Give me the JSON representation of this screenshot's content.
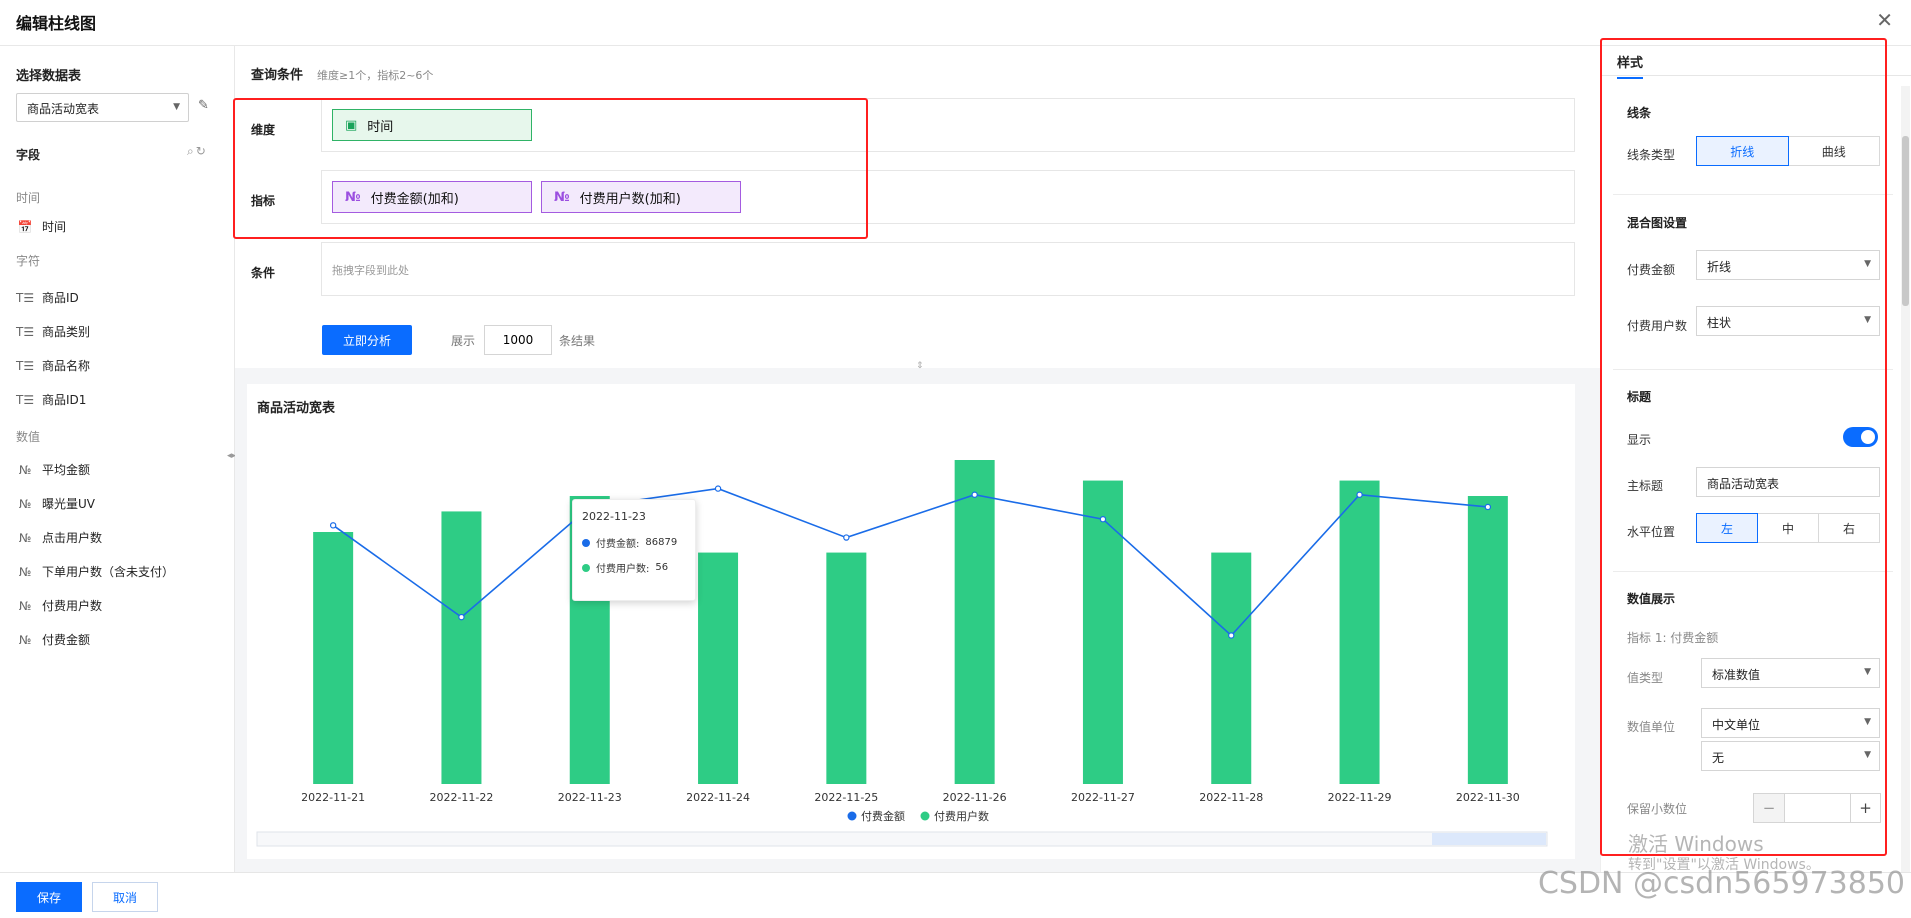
{
  "header": {
    "title": "编辑柱线图",
    "close_glyph": "✕"
  },
  "sidebar": {
    "title": "选择数据表",
    "dataset": "商品活动宽表",
    "fields_label": "字段",
    "groups": [
      {
        "label": "时间",
        "items": [
          {
            "label": "时间",
            "icon": "calendar-icon"
          }
        ]
      },
      {
        "label": "字符",
        "items": [
          {
            "label": "商品ID",
            "icon": "text-field-icon"
          },
          {
            "label": "商品类别",
            "icon": "text-field-icon"
          },
          {
            "label": "商品名称",
            "icon": "text-field-icon"
          },
          {
            "label": "商品ID1",
            "icon": "text-field-icon"
          }
        ]
      },
      {
        "label": "数值",
        "items": [
          {
            "label": "平均金额",
            "icon": "number-field-icon"
          },
          {
            "label": "曝光量UV",
            "icon": "number-field-icon"
          },
          {
            "label": "点击用户数",
            "icon": "number-field-icon"
          },
          {
            "label": "下单用户数（含未支付）",
            "icon": "number-field-icon"
          },
          {
            "label": "付费用户数",
            "icon": "number-field-icon"
          },
          {
            "label": "付费金额",
            "icon": "number-field-icon"
          }
        ]
      }
    ]
  },
  "query": {
    "title": "查询条件",
    "hint": "维度≥1个，指标2~6个",
    "dimension_label": "维度",
    "dimension_chip": "时间",
    "metric_label": "指标",
    "metric_chips": [
      "付费金额(加和)",
      "付费用户数(加和)"
    ],
    "condition_label": "条件",
    "condition_placeholder": "拖拽字段到此处",
    "analyze_button": "立即分析",
    "show_prefix": "展示",
    "limit": "1000",
    "show_suffix": "条结果",
    "number_glyph": "№"
  },
  "chart_data": {
    "type": "bar-line",
    "title": "商品活动宽表",
    "categories": [
      "2022-11-21",
      "2022-11-22",
      "2022-11-23",
      "2022-11-24",
      "2022-11-25",
      "2022-11-26",
      "2022-11-27",
      "2022-11-28",
      "2022-11-29",
      "2022-11-30"
    ],
    "series": [
      {
        "name": "付费金额",
        "type": "line",
        "color": "#1a6ce8",
        "values": [
          79000,
          64000,
          82000,
          85000,
          77000,
          84000,
          80000,
          61000,
          84000,
          82000
        ]
      },
      {
        "name": "付费用户数",
        "type": "bar",
        "color": "#2ecc85",
        "values": [
          49,
          53,
          56,
          45,
          45,
          63,
          59,
          45,
          59,
          56
        ]
      }
    ],
    "legend_position": "bottom-center",
    "tooltip": {
      "date": "2022-11-23",
      "rows": [
        {
          "label": "付费金额:",
          "value": "86879",
          "color": "#1a6ce8"
        },
        {
          "label": "付费用户数:",
          "value": "56",
          "color": "#2ecc85"
        }
      ]
    }
  },
  "style_panel": {
    "tab": "样式",
    "line_section": "线条",
    "line_type_label": "线条类型",
    "line_type_options": [
      "折线",
      "曲线"
    ],
    "line_type_selected": "折线",
    "mix_section": "混合图设置",
    "mix_rows": [
      {
        "label": "付费金额",
        "value": "折线"
      },
      {
        "label": "付费用户数",
        "value": "柱状"
      }
    ],
    "title_section": "标题",
    "show_label": "显示",
    "show_enabled": true,
    "main_title_label": "主标题",
    "main_title_value": "商品活动宽表",
    "hpos_label": "水平位置",
    "hpos_options": [
      "左",
      "中",
      "右"
    ],
    "hpos_selected": "左",
    "value_section": "数值展示",
    "metric1_label": "指标 1: 付费金额",
    "value_type_label": "值类型",
    "value_type": "标准数值",
    "unit_label": "数值单位",
    "unit_value": "中文单位",
    "unit_sub_value": "无",
    "decimals_label": "保留小数位"
  },
  "footer": {
    "save": "保存",
    "cancel": "取消"
  },
  "overlay": {
    "windows_line1": "激活 Windows",
    "windows_line2": "转到\"设置\"以激活 Windows。",
    "csdn": "CSDN @csdn565973850"
  },
  "colors": {
    "primary": "#0a6cff",
    "highlight_red": "#ff1f1f"
  }
}
